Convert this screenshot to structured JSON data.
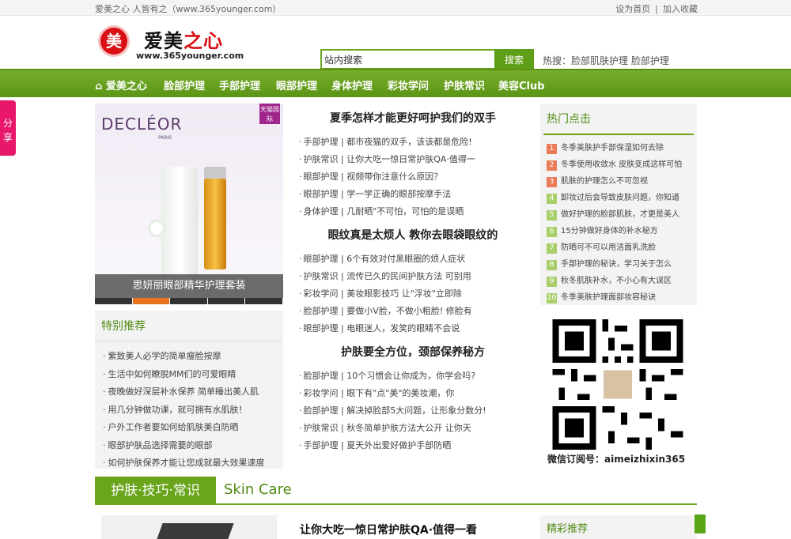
{
  "topbar": {
    "left": "爱美之心 人皆有之（www.365younger.com）",
    "home": "设为首页",
    "fav": "加入收藏"
  },
  "logo": {
    "mark": "美",
    "name_a": "爱美",
    "name_b": "之心",
    "url": "www.365younger.com"
  },
  "search": {
    "value": "站内搜索",
    "button": "搜索"
  },
  "hot_words": {
    "label": "热搜：",
    "words": "脸部肌肤护理 脸部护理"
  },
  "nav": [
    "爱美之心",
    "脸部护理",
    "手部护理",
    "眼部护理",
    "身体护理",
    "彩妆学问",
    "护肤常识",
    "美容Club"
  ],
  "share": "分享",
  "banner": {
    "brand": "DECLÉOR",
    "sub": "PARIS",
    "tag": "天猫国际",
    "caption": "思妍丽眼部精华护理套装"
  },
  "special": {
    "title": "特别推荐",
    "items": [
      "紫致美人必学的简单瘦脸按摩",
      "生活中如何瞭脱MM们的可爱眼睛",
      "夜晚做好深层补水保养 简单睡出美人肌",
      "用几分钟做功课，就可拥有水肌肤！",
      "户外工作者要如何给肌肤美白防晒",
      "眼部护肤品选择需要的眼部",
      "如何护肤保养才能让您成就最大效果速度"
    ]
  },
  "blocks": [
    {
      "title": "夏季怎样才能更好呵护我们的双手",
      "items": [
        "手部护理 | 都市夜猫的双手，该该都是危险!",
        "护肤常识 | 让你大吃一惊日常护肤QA·值得一",
        "眼部护理 | 视频带你注意什么原因？",
        "眼部护理 | 学一学正确的眼部按摩手法",
        "身体护理 | 几耐晒\"不可怕，可怕的是误晒"
      ]
    },
    {
      "title": "眼纹真是太烦人 教你去眼袋眼纹的",
      "items": [
        "眼部护理 | 6个有效对付黑眼圈的烦人症状",
        "护肤常识 | 流传已久的民间护肤方法 可别用",
        "彩妆学问 | 美妆眼影技巧 让\"浮妆\"立即除",
        "脸部护理 | 要做小V脸，不做小粗脸! 修脸有",
        "眼部护理 | 电眼迷人，发笑的眼睛不会说"
      ]
    },
    {
      "title": "护肤要全方位，颈部保养秘方",
      "items": [
        "脸部护理 | 10个习惯会让你成为，你学会吗?",
        "彩妆学问 | 眼下有\"点\"美\"的美妆潮，你",
        "脸部护理 | 解决掉脸部5大问题，让形象分数分!",
        "护肤常识 | 秋冬简单护肤方法大公开 让你天",
        "手部护理 | 夏天外出爱好做护手部防晒"
      ]
    }
  ],
  "hot_box": {
    "title": "热门点击",
    "items": [
      "冬季美肤护手部保湿如何去除",
      "冬季使用收敛水 皮肤变成这样可怕",
      "肌肤的护理怎么不可忽视",
      "卸妆过后会导致皮肤问题，你知道",
      "做好护理的脸部肌肤，才更是美人",
      "15分钟做好身体的补水秘方",
      "防晒可不可以用洁面乳洗脸",
      "手部护理的秘诀，学习关于怎么",
      "秋冬肌肤补水，不小心有大误区",
      "冬季美肤护理面部妆容秘诀"
    ]
  },
  "qr": {
    "caption": "微信订阅号：aimeizhixin365"
  },
  "skin_care": {
    "tab": "护肤·技巧·常识",
    "en": "Skin Care"
  },
  "lower": {
    "title": "让你大吃一惊日常护肤QA·值得一看",
    "right_title": "精彩推荐"
  }
}
